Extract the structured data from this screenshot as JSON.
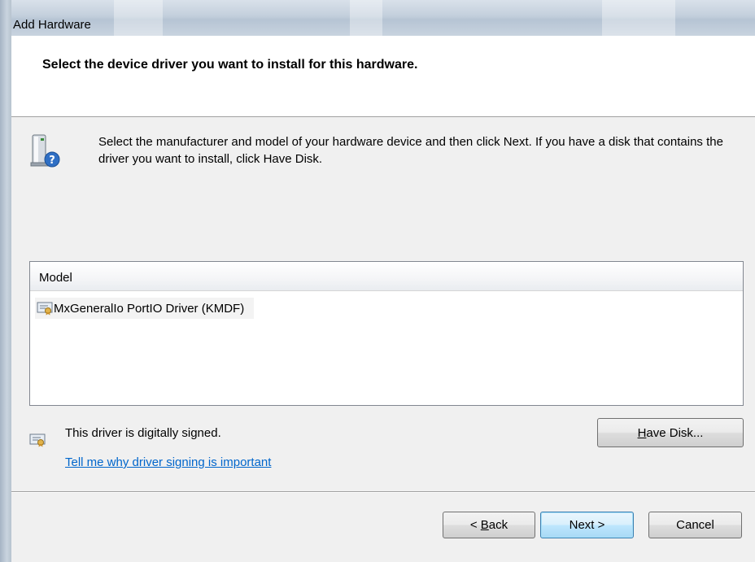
{
  "window": {
    "title": "Add Hardware"
  },
  "header": {
    "title": "Select the device driver you want to install for this hardware."
  },
  "instruction": "Select the manufacturer and model of your hardware device and then click Next. If you have a disk that contains the driver you want to install, click Have Disk.",
  "model_list": {
    "column_header": "Model",
    "items": [
      {
        "label": "MxGeneralIo PortIO Driver (KMDF)",
        "icon": "certified-driver-icon"
      }
    ]
  },
  "signing": {
    "status_text": "This driver is digitally signed.",
    "link_text": "Tell me why driver signing is important",
    "icon": "certified-driver-icon"
  },
  "buttons": {
    "have_disk": {
      "accel": "H",
      "rest": "ave Disk..."
    },
    "back": {
      "prefix": "< ",
      "accel": "B",
      "rest": "ack"
    },
    "next": "Next >",
    "cancel": "Cancel"
  },
  "colors": {
    "link": "#0066cc",
    "header_bg": "#ffffff",
    "dialog_bg": "#f0f0f0"
  }
}
